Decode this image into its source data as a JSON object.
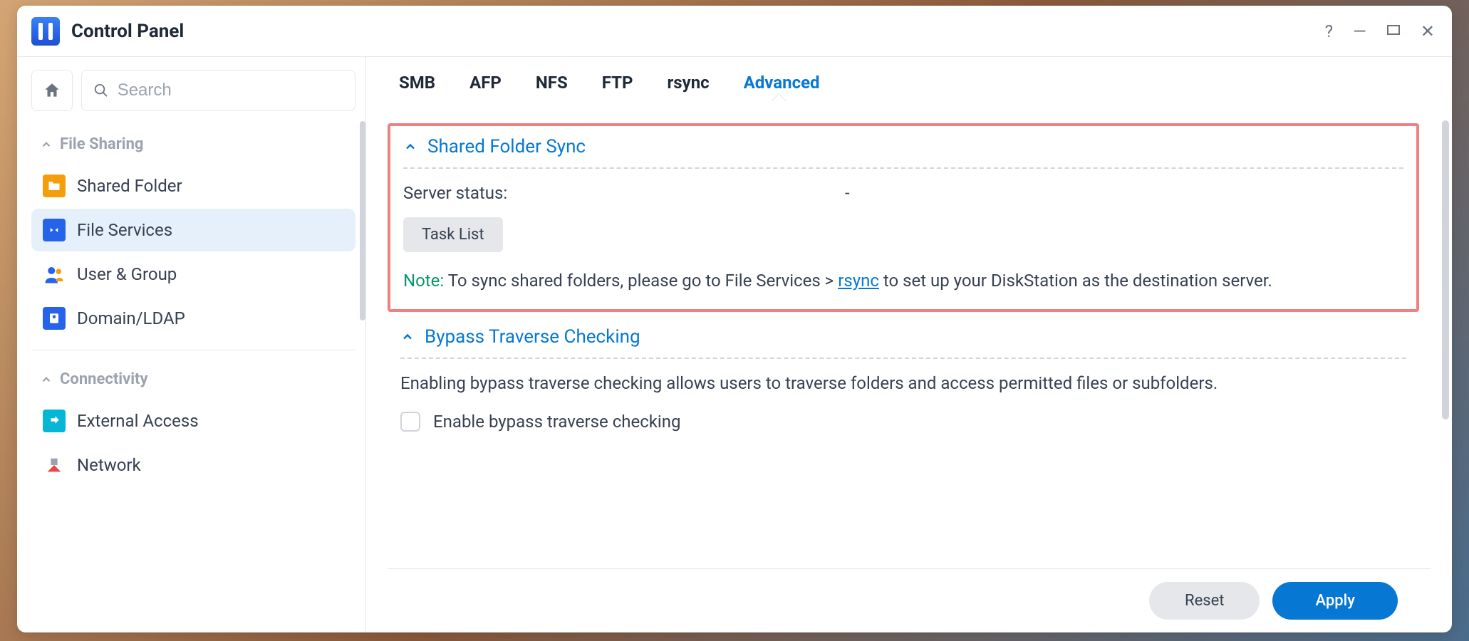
{
  "window": {
    "title": "Control Panel"
  },
  "sidebar": {
    "search_placeholder": "Search",
    "sections": {
      "file_sharing": {
        "label": "File Sharing",
        "items": [
          {
            "label": "Shared Folder"
          },
          {
            "label": "File Services"
          },
          {
            "label": "User & Group"
          },
          {
            "label": "Domain/LDAP"
          }
        ]
      },
      "connectivity": {
        "label": "Connectivity",
        "items": [
          {
            "label": "External Access"
          },
          {
            "label": "Network"
          }
        ]
      }
    }
  },
  "tabs": [
    {
      "label": "SMB"
    },
    {
      "label": "AFP"
    },
    {
      "label": "NFS"
    },
    {
      "label": "FTP"
    },
    {
      "label": "rsync"
    },
    {
      "label": "Advanced",
      "active": true
    }
  ],
  "shared_folder_sync": {
    "title": "Shared Folder Sync",
    "server_status_label": "Server status:",
    "server_status_value": "-",
    "task_list_button": "Task List",
    "note_label": "Note:",
    "note_before": " To sync shared folders, please go to File Services > ",
    "note_link": "rsync",
    "note_after": " to set up your DiskStation as the destination server."
  },
  "bypass": {
    "title": "Bypass Traverse Checking",
    "description": "Enabling bypass traverse checking allows users to traverse folders and access permitted files or subfolders.",
    "checkbox_label": "Enable bypass traverse checking"
  },
  "footer": {
    "reset": "Reset",
    "apply": "Apply"
  }
}
